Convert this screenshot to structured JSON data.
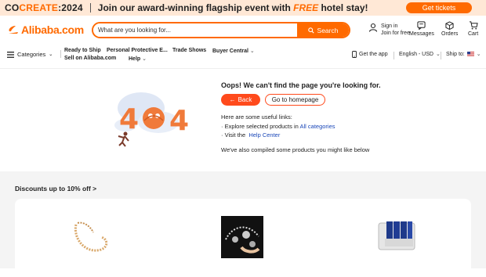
{
  "promo": {
    "brand_prefix": "CO",
    "brand_accent": "CREATE",
    "brand_year": "2024",
    "text_before": "Join our award-winning flagship event with ",
    "text_free": "FREE",
    "text_after": " hotel stay!",
    "cta": "Get tickets"
  },
  "header": {
    "logo": "Alibaba.com",
    "search_placeholder": "What are you looking for...",
    "search_button": "Search",
    "signin_line1": "Sign in",
    "signin_line2": "Join for free",
    "messages": "Messages",
    "orders": "Orders",
    "cart": "Cart"
  },
  "nav": {
    "categories": "Categories",
    "ready_to_ship": "Ready to Ship",
    "sell_on": "Sell on Alibaba.com",
    "ppe": "Personal Protective E...",
    "help": "Help",
    "trade_shows": "Trade Shows",
    "buyer_central": "Buyer Central",
    "get_app": "Get the app",
    "language": "English - USD",
    "ship_to": "Ship to:"
  },
  "error": {
    "title": "Oops! We can't find the page you're looking for.",
    "back": "Back",
    "home": "Go to homepage",
    "links_intro": "Here are some useful links:",
    "explore_prefix": "· Explore selected products in ",
    "explore_link": "All categories",
    "visit_prefix": "· Visit the ",
    "visit_link": "Help Center",
    "compiled": "We've also compiled some products you might like below"
  },
  "recs": {
    "title": "Discounts up to 10% off >"
  },
  "colors": {
    "brand_orange": "#ff6a00",
    "promo_bg": "#ffe8d6",
    "link_blue": "#1a47b8",
    "back_red": "#ff4a1c"
  }
}
